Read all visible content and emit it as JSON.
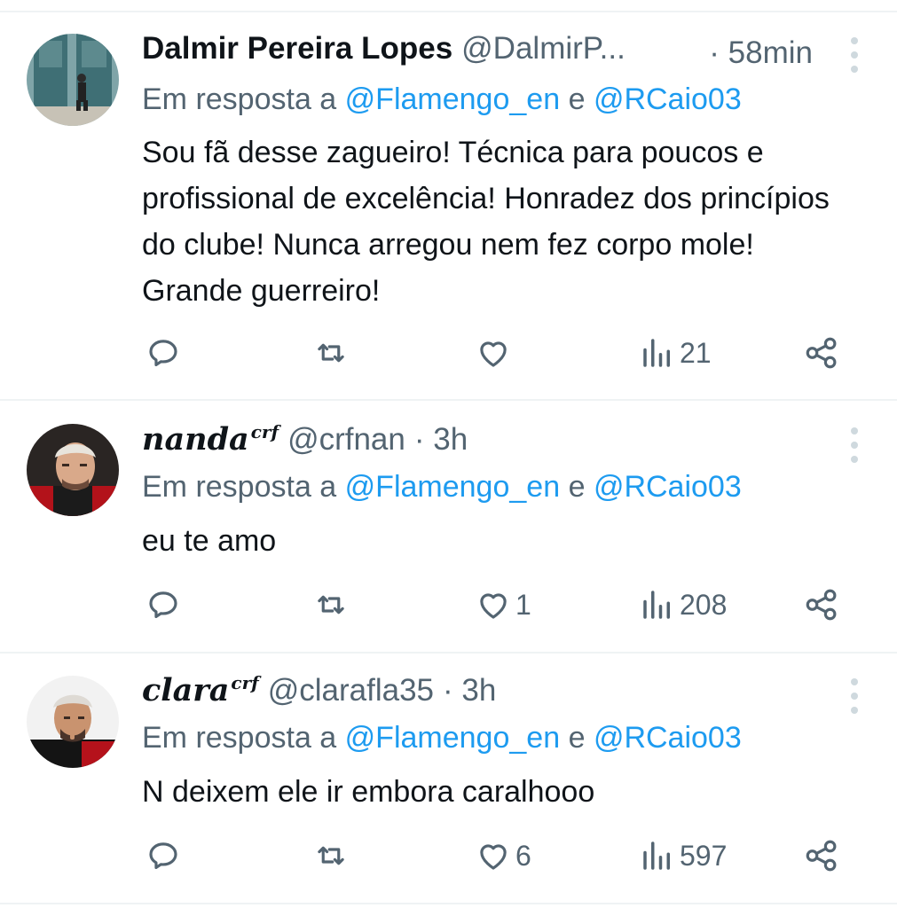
{
  "tweets": [
    {
      "name": "Dalmir Pereira Lopes",
      "name_sup": "",
      "handle": "@DalmirP...",
      "time": "· 58min",
      "reply_prefix": "Em resposta a",
      "mention1": "@Flamengo_en",
      "reply_and": "e",
      "mention2": "@RCaio03",
      "text": "Sou fã desse zagueiro! Técnica para poucos e profissional de excelência! Honradez dos princípios do clube! Nunca arregou nem fez corpo mole! Grande guerreiro!",
      "likes": "",
      "views": "21"
    },
    {
      "name": "nanda",
      "name_sup": "crf",
      "handle": "@crfnan",
      "time": "· 3h",
      "reply_prefix": "Em resposta a",
      "mention1": "@Flamengo_en",
      "reply_and": "e",
      "mention2": "@RCaio03",
      "text": "eu te amo",
      "likes": "1",
      "views": "208"
    },
    {
      "name": "clara",
      "name_sup": "crf",
      "handle": "@clarafla35",
      "time": "· 3h",
      "reply_prefix": "Em resposta a",
      "mention1": "@Flamengo_en",
      "reply_and": "e",
      "mention2": "@RCaio03",
      "text": "N deixem ele ir embora caralhooo",
      "likes": "6",
      "views": "597"
    }
  ],
  "icons": {
    "reply": "reply-icon",
    "retweet": "retweet-icon",
    "like": "heart-icon",
    "views": "views-icon",
    "share": "share-icon",
    "more": "more-icon"
  },
  "colors": {
    "text": "#0f1419",
    "secondary": "#536471",
    "mention": "#1d9bf0",
    "divider": "#eff3f4"
  }
}
